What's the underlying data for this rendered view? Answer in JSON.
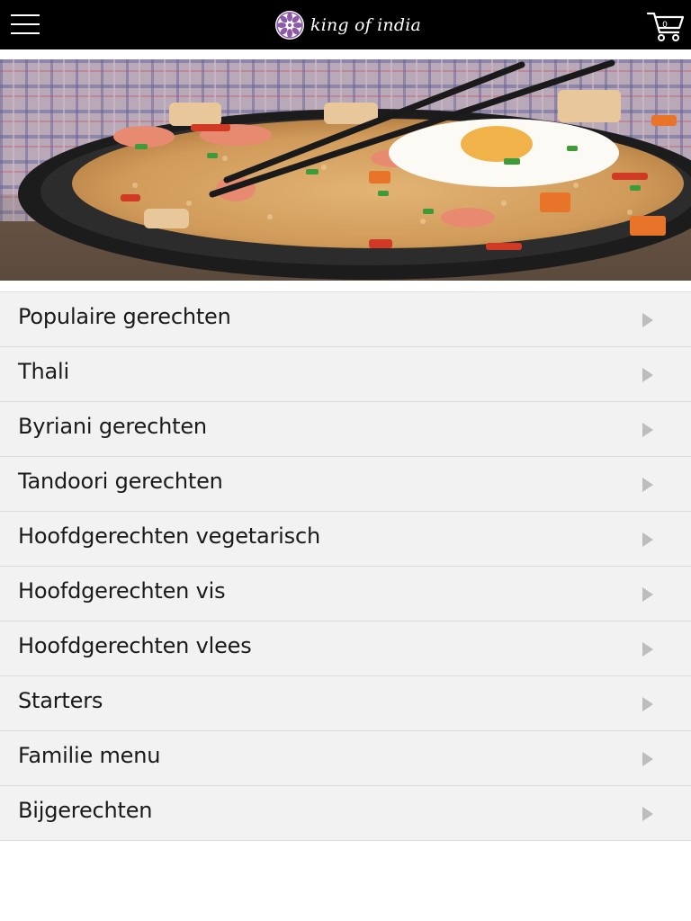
{
  "header": {
    "logo_text": "king of india",
    "cart_count": "0",
    "icons": {
      "menu": "hamburger-menu-icon",
      "logo": "mandala-logo-icon",
      "cart": "shopping-cart-icon"
    }
  },
  "hero": {
    "icon": "food-photo-fried-rice"
  },
  "menu": {
    "items": [
      {
        "label": "Populaire gerechten"
      },
      {
        "label": "Thali"
      },
      {
        "label": "Byriani gerechten"
      },
      {
        "label": "Tandoori gerechten"
      },
      {
        "label": "Hoofdgerechten vegetarisch"
      },
      {
        "label": "Hoofdgerechten vis"
      },
      {
        "label": "Hoofdgerechten vlees"
      },
      {
        "label": "Starters"
      },
      {
        "label": "Familie menu"
      },
      {
        "label": "Bijgerechten"
      }
    ]
  },
  "colors": {
    "header_bg": "#000000",
    "row_bg": "#f2f2f2",
    "row_border": "#dcdcdc",
    "arrow": "#bdbdbd",
    "logo_accent": "#8e5aa8"
  }
}
